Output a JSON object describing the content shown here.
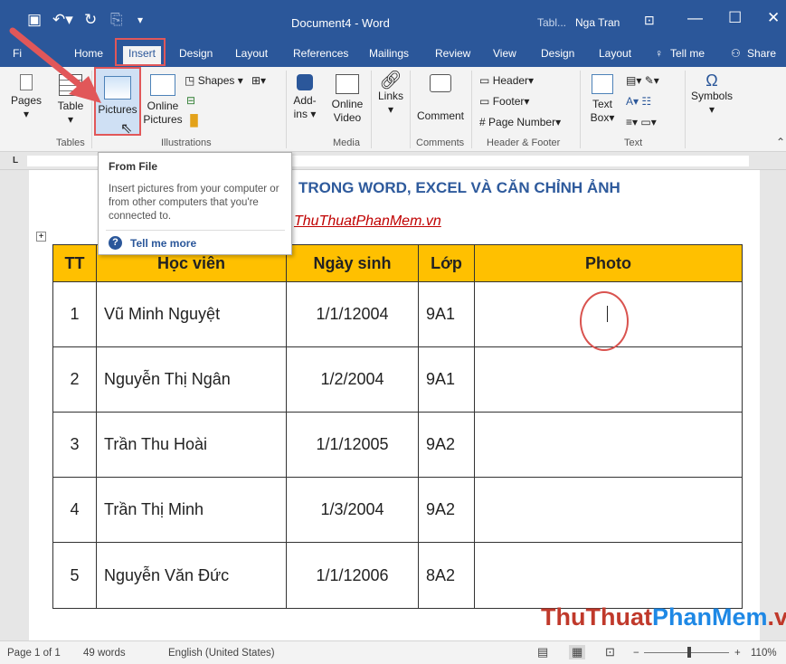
{
  "window": {
    "title": "Document4 - Word",
    "table_tools": "Tabl...",
    "user": "Nga Tran"
  },
  "tabs": [
    "Fi",
    "Home",
    "Insert",
    "Design",
    "Layout",
    "References",
    "Mailings",
    "Review",
    "View",
    "Design",
    "Layout",
    "Tell me",
    "Share"
  ],
  "ribbon": {
    "pages": "Pages",
    "table": "Table",
    "pictures": "Pictures",
    "online_pictures_1": "Online",
    "online_pictures_2": "Pictures",
    "shapes": "Shapes",
    "addins_1": "Add-",
    "addins_2": "ins",
    "online_video_1": "Online",
    "online_video_2": "Video",
    "links": "Links",
    "comment": "Comment",
    "header": "Header",
    "footer": "Footer",
    "page_number": "Page Number",
    "textbox_1": "Text",
    "textbox_2": "Box",
    "symbols": "Symbols",
    "groups": {
      "tables": "Tables",
      "illustrations": "Illustrations",
      "media": "Media",
      "comments": "Comments",
      "header_footer": "Header & Footer",
      "text": "Text"
    }
  },
  "tooltip": {
    "title": "From File",
    "body": "Insert pictures from your computer or from other computers that you're connected to.",
    "more": "Tell me more"
  },
  "document": {
    "heading": "TRONG WORD, EXCEL VÀ CĂN CHỈNH ẢNH",
    "link": "ThuThuatPhanMem.vn",
    "table_headers": [
      "TT",
      "Học viên",
      "Ngày sinh",
      "Lớp",
      "Photo"
    ],
    "rows": [
      [
        "1",
        "Vũ Minh Nguyệt",
        "1/1/12004",
        "9A1"
      ],
      [
        "2",
        "Nguyễn Thị Ngân",
        "1/2/2004",
        "9A1"
      ],
      [
        "3",
        "Trần Thu Hoài",
        "1/1/12005",
        "9A2"
      ],
      [
        "4",
        "Trần Thị Minh",
        "1/3/2004",
        "9A2"
      ],
      [
        "5",
        "Nguyễn Văn Đức",
        "1/1/12006",
        "8A2"
      ]
    ]
  },
  "watermark": {
    "part1": "ThuThuat",
    "part2": "PhanMem",
    "part3": ".vn"
  },
  "status": {
    "page": "Page 1 of 1",
    "words": "49 words",
    "language": "English (United States)",
    "zoom": "110%"
  },
  "colors": {
    "word_blue": "#2b579a",
    "header_fill": "#ffc000",
    "annotation_red": "#d9534f"
  }
}
